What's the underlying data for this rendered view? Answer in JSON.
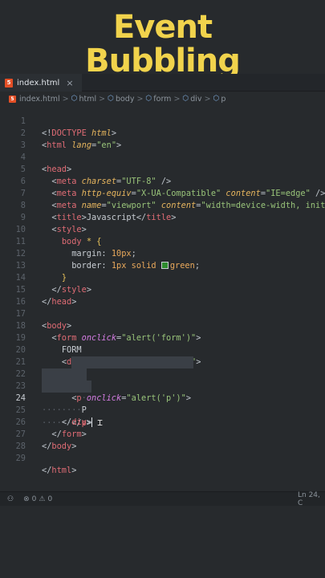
{
  "header": {
    "title_line1": "Event",
    "title_line2": "Bubbling"
  },
  "tab": {
    "label": "index.html",
    "close": "×",
    "icon_text": "5"
  },
  "breadcrumb": {
    "items": [
      "index.html",
      "html",
      "body",
      "form",
      "div",
      "p"
    ],
    "separator": ">"
  },
  "editor": {
    "active_line": 24,
    "line_numbers": [
      "1",
      "2",
      "3",
      "4",
      "5",
      "6",
      "7",
      "8",
      "9",
      "10",
      "11",
      "12",
      "13",
      "14",
      "15",
      "16",
      "17",
      "18",
      "19",
      "20",
      "21",
      "22",
      "23",
      "24",
      "25",
      "26",
      "27",
      "28",
      "29",
      "30"
    ]
  },
  "statusbar": {
    "errors": "0",
    "warnings": "0",
    "position": "Ln 24, C"
  },
  "colors": {
    "title": "#f1d34c",
    "background": "#272a2d",
    "tag": "#e06c75",
    "attribute": "#e6b55e",
    "string": "#98c379",
    "color_swatch": "#2e8b2e"
  }
}
